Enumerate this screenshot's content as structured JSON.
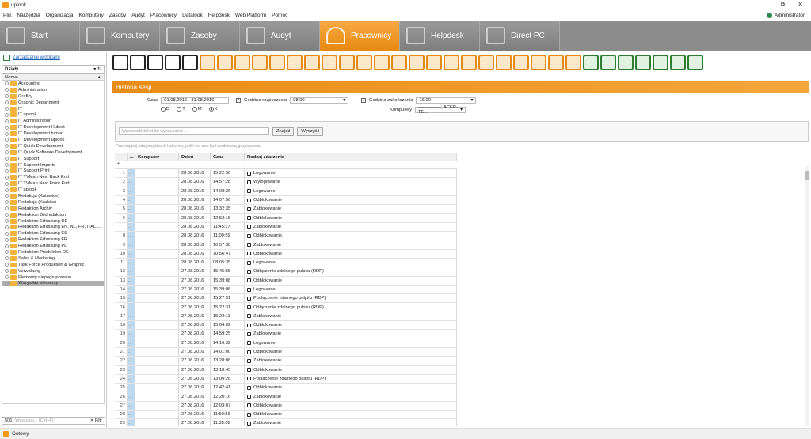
{
  "window": {
    "title": "uplook",
    "controls": [
      "⧉",
      "✕"
    ]
  },
  "menu": {
    "items": [
      "Plik",
      "Narzędzia",
      "Organizacja",
      "Komputery",
      "Zasoby",
      "Audyt",
      "Pracownicy",
      "Datalook",
      "Helpdesk",
      "Web Platform",
      "Pomoc"
    ],
    "user": "Administrator"
  },
  "nav": {
    "tabs": [
      {
        "label": "Start",
        "icon": "house-icon"
      },
      {
        "label": "Komputery",
        "icon": "computer-icon"
      },
      {
        "label": "Zasoby",
        "icon": "boxes-icon"
      },
      {
        "label": "Audyt",
        "icon": "disc-icon"
      },
      {
        "label": "Pracownicy",
        "icon": "people-icon"
      },
      {
        "label": "Helpdesk",
        "icon": "headset-icon"
      },
      {
        "label": "Direct PC",
        "icon": "monitor-icon"
      }
    ],
    "active_index": 4,
    "active_color": "#f29a27"
  },
  "left": {
    "manage_link": "Zarządzanie widokami",
    "dept_selector": "Działy",
    "tree_header": "Nazwa",
    "tree": [
      "Accounting",
      "Administration",
      "Graficy",
      "Graphic Department",
      "IT",
      "IT uplook",
      "IT Administration",
      "IT Development Hubert",
      "IT Development tvman",
      "IT Development uplook",
      "IT Quick Development",
      "IT Quick Software Development",
      "IT Support",
      "IT Support Imports",
      "IT Support Print",
      "IT TVMan Next Back End",
      "IT TVMan Next Front End",
      "IT uplook",
      "Redakcja (Katowice)",
      "Redakcja (Kraków)",
      "Redaktion Archiv",
      "Redaktion Bildredaktion",
      "Redaktion Erfassung DE",
      "Redaktion Erfassung EN, NL, FR, ITAL,...",
      "Redaktion Erfassung ES",
      "Redaktion Erfassung FR",
      "Redaktion Erfassung PL",
      "Redaktion Produktion DE",
      "Sales & Marketing",
      "Task Force Produktion & Graphic",
      "Verwaltung",
      "Elementy niepogrupowane",
      "Wszystkie elementy"
    ],
    "selected_index": 32,
    "search_count": "506",
    "search_placeholder": "Wyszukaj... (Ctrl+F)",
    "filter_label": "Filtr"
  },
  "toolbar": {
    "icons": [
      "home-icon",
      "refresh-icon",
      "settings-icon",
      "save-icon",
      "print-icon",
      "users-icon",
      "user-attach-icon",
      "user-group-icon",
      "user-doc-icon",
      "user-chart-icon",
      "user-search-icon",
      "user-edit-icon",
      "user-alert-icon",
      "user-calendar-icon",
      "calendar-icon",
      "calendar-clock-icon",
      "monitor-user-icon",
      "monitor-clock-icon",
      "window-icon",
      "cursor-icon",
      "counter-icon",
      "calendar-day-icon",
      "signal-icon",
      "user-chart2-icon",
      "printer-icon",
      "desk-icon",
      "chat-alert-icon",
      "network-icon",
      "network-speed-icon",
      "usb-icon",
      "usb2-icon",
      "usb3-icon",
      "usb4-icon",
      "transfer-icon"
    ]
  },
  "section_title": "Historia sesji",
  "filters": {
    "time_label": "Czas",
    "time_value": "01.08.2016 - 31.08.2016",
    "start_label": "Godzina rozpoczęcia",
    "start_value": "08:00",
    "end_label": "Godzina zakończenia",
    "end_value": "16:00",
    "computers_label": "Komputery",
    "computers_value": "---------------, ACER-TE...",
    "radios": [
      "D",
      "T",
      "M",
      "K"
    ],
    "radio_selected": 3
  },
  "search": {
    "placeholder": "Wprowadź tekst do wyszukania ...",
    "find": "Znajdź",
    "clear": "Wyczyść",
    "group_hint": "Przeciągnij tutaj nagłówek kolumny, jeśli ma ona być podstawą grupowania"
  },
  "grid": {
    "columns": [
      "...",
      "Komputer",
      "Dzień",
      "Czas",
      "Rodzaj zdarzenia"
    ],
    "rows": [
      {
        "n": "1",
        "date": "28.08.2016",
        "time": "15:22:36",
        "event": "Logowanie"
      },
      {
        "n": "2",
        "date": "28.08.2016",
        "time": "14:57:28",
        "event": "Wylogowanie"
      },
      {
        "n": "3",
        "date": "28.08.2016",
        "time": "14:08:26",
        "event": "Logowanie"
      },
      {
        "n": "4",
        "date": "28.08.2016",
        "time": "14:07:56",
        "event": "Odblokowanie"
      },
      {
        "n": "5",
        "date": "28.08.2016",
        "time": "13:32:35",
        "event": "Zablokowanie"
      },
      {
        "n": "6",
        "date": "28.08.2016",
        "time": "12:53:15",
        "event": "Odblokowanie"
      },
      {
        "n": "7",
        "date": "28.08.2016",
        "time": "11:45:17",
        "event": "Zablokowanie"
      },
      {
        "n": "8",
        "date": "28.08.2016",
        "time": "11:00:59",
        "event": "Odblokowanie"
      },
      {
        "n": "9",
        "date": "28.08.2016",
        "time": "10:57:38",
        "event": "Zablokowanie"
      },
      {
        "n": "10",
        "date": "28.08.2016",
        "time": "10:56:47",
        "event": "Odblokowanie"
      },
      {
        "n": "11",
        "date": "28.08.2016",
        "time": "08:05:35",
        "event": "Logowanie"
      },
      {
        "n": "12",
        "date": "27.08.2016",
        "time": "15:45:55",
        "event": "Odłączenie zdalnego pulpitu (RDP)"
      },
      {
        "n": "13",
        "date": "27.08.2016",
        "time": "15:39:08",
        "event": "Odblokowanie"
      },
      {
        "n": "14",
        "date": "27.08.2016",
        "time": "15:39:08",
        "event": "Logowanie"
      },
      {
        "n": "15",
        "date": "27.08.2016",
        "time": "15:27:51",
        "event": "Podłączenie zdalnego pulpitu (RDP)"
      },
      {
        "n": "16",
        "date": "27.08.2016",
        "time": "15:22:31",
        "event": "Odłączenie zdalnego pulpitu (RDP)"
      },
      {
        "n": "17",
        "date": "27.08.2016",
        "time": "15:22:11",
        "event": "Zablokowanie"
      },
      {
        "n": "18",
        "date": "27.08.2016",
        "time": "15:04:02",
        "event": "Odblokowanie"
      },
      {
        "n": "19",
        "date": "27.08.2016",
        "time": "14:59:25",
        "event": "Zablokowanie"
      },
      {
        "n": "20",
        "date": "27.08.2016",
        "time": "14:16:32",
        "event": "Logowanie"
      },
      {
        "n": "21",
        "date": "27.08.2016",
        "time": "14:01:00",
        "event": "Odblokowanie"
      },
      {
        "n": "22",
        "date": "27.08.2016",
        "time": "13:28:08",
        "event": "Zablokowanie"
      },
      {
        "n": "23",
        "date": "27.08.2016",
        "time": "13:18:45",
        "event": "Odblokowanie"
      },
      {
        "n": "24",
        "date": "27.08.2016",
        "time": "13:00:26",
        "event": "Podłączenie zdalnego pulpitu (RDP)"
      },
      {
        "n": "25",
        "date": "27.08.2016",
        "time": "12:42:41",
        "event": "Odblokowanie"
      },
      {
        "n": "26",
        "date": "27.08.2016",
        "time": "12:20:16",
        "event": "Zablokowanie"
      },
      {
        "n": "27",
        "date": "27.08.2016",
        "time": "12:03:07",
        "event": "Odblokowanie"
      },
      {
        "n": "28",
        "date": "27.08.2016",
        "time": "11:50:56",
        "event": "Odblokowanie"
      },
      {
        "n": "29",
        "date": "27.08.2016",
        "time": "11:35:08",
        "event": "Zablokowanie"
      }
    ]
  },
  "status": "Gotowy"
}
